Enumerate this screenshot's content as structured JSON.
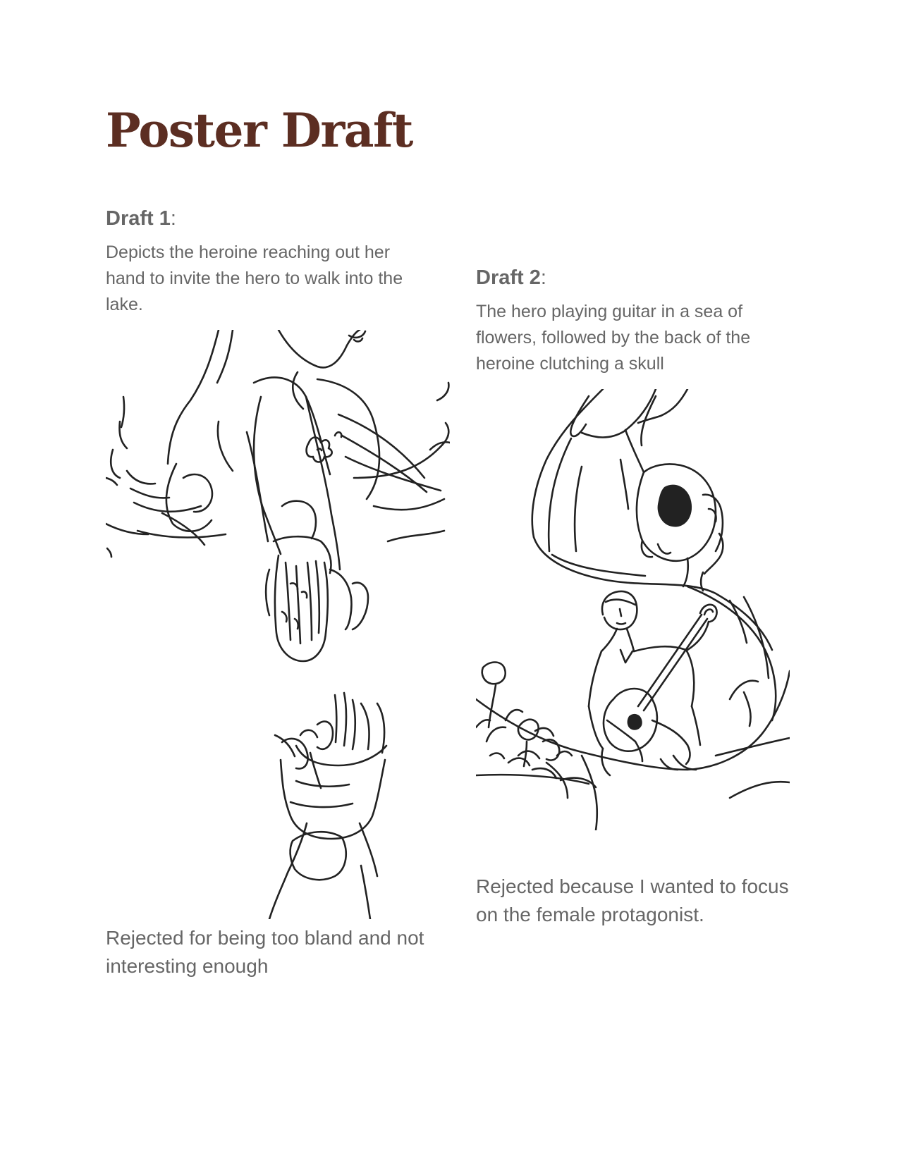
{
  "page": {
    "title": "Poster Draft"
  },
  "drafts": [
    {
      "heading": "Draft 1",
      "colon": ":",
      "description": "Depicts the heroine reaching out her hand to invite the hero to walk into the lake.",
      "sketch_subject": "heroine reaching down toward an upturned hand",
      "verdict": "Rejected for being too bland and not interesting enough"
    },
    {
      "heading": "Draft 2",
      "colon": ":",
      "description": "The hero playing guitar in a sea of flowers, followed by the back of the heroine clutching a skull",
      "sketch_subject": "hero playing guitar among flowers with heroine holding a skull",
      "verdict": "Rejected because I wanted to focus on the female protagonist."
    }
  ],
  "colors": {
    "title": "#5c2e22",
    "text": "#666666",
    "ink": "#222222"
  }
}
